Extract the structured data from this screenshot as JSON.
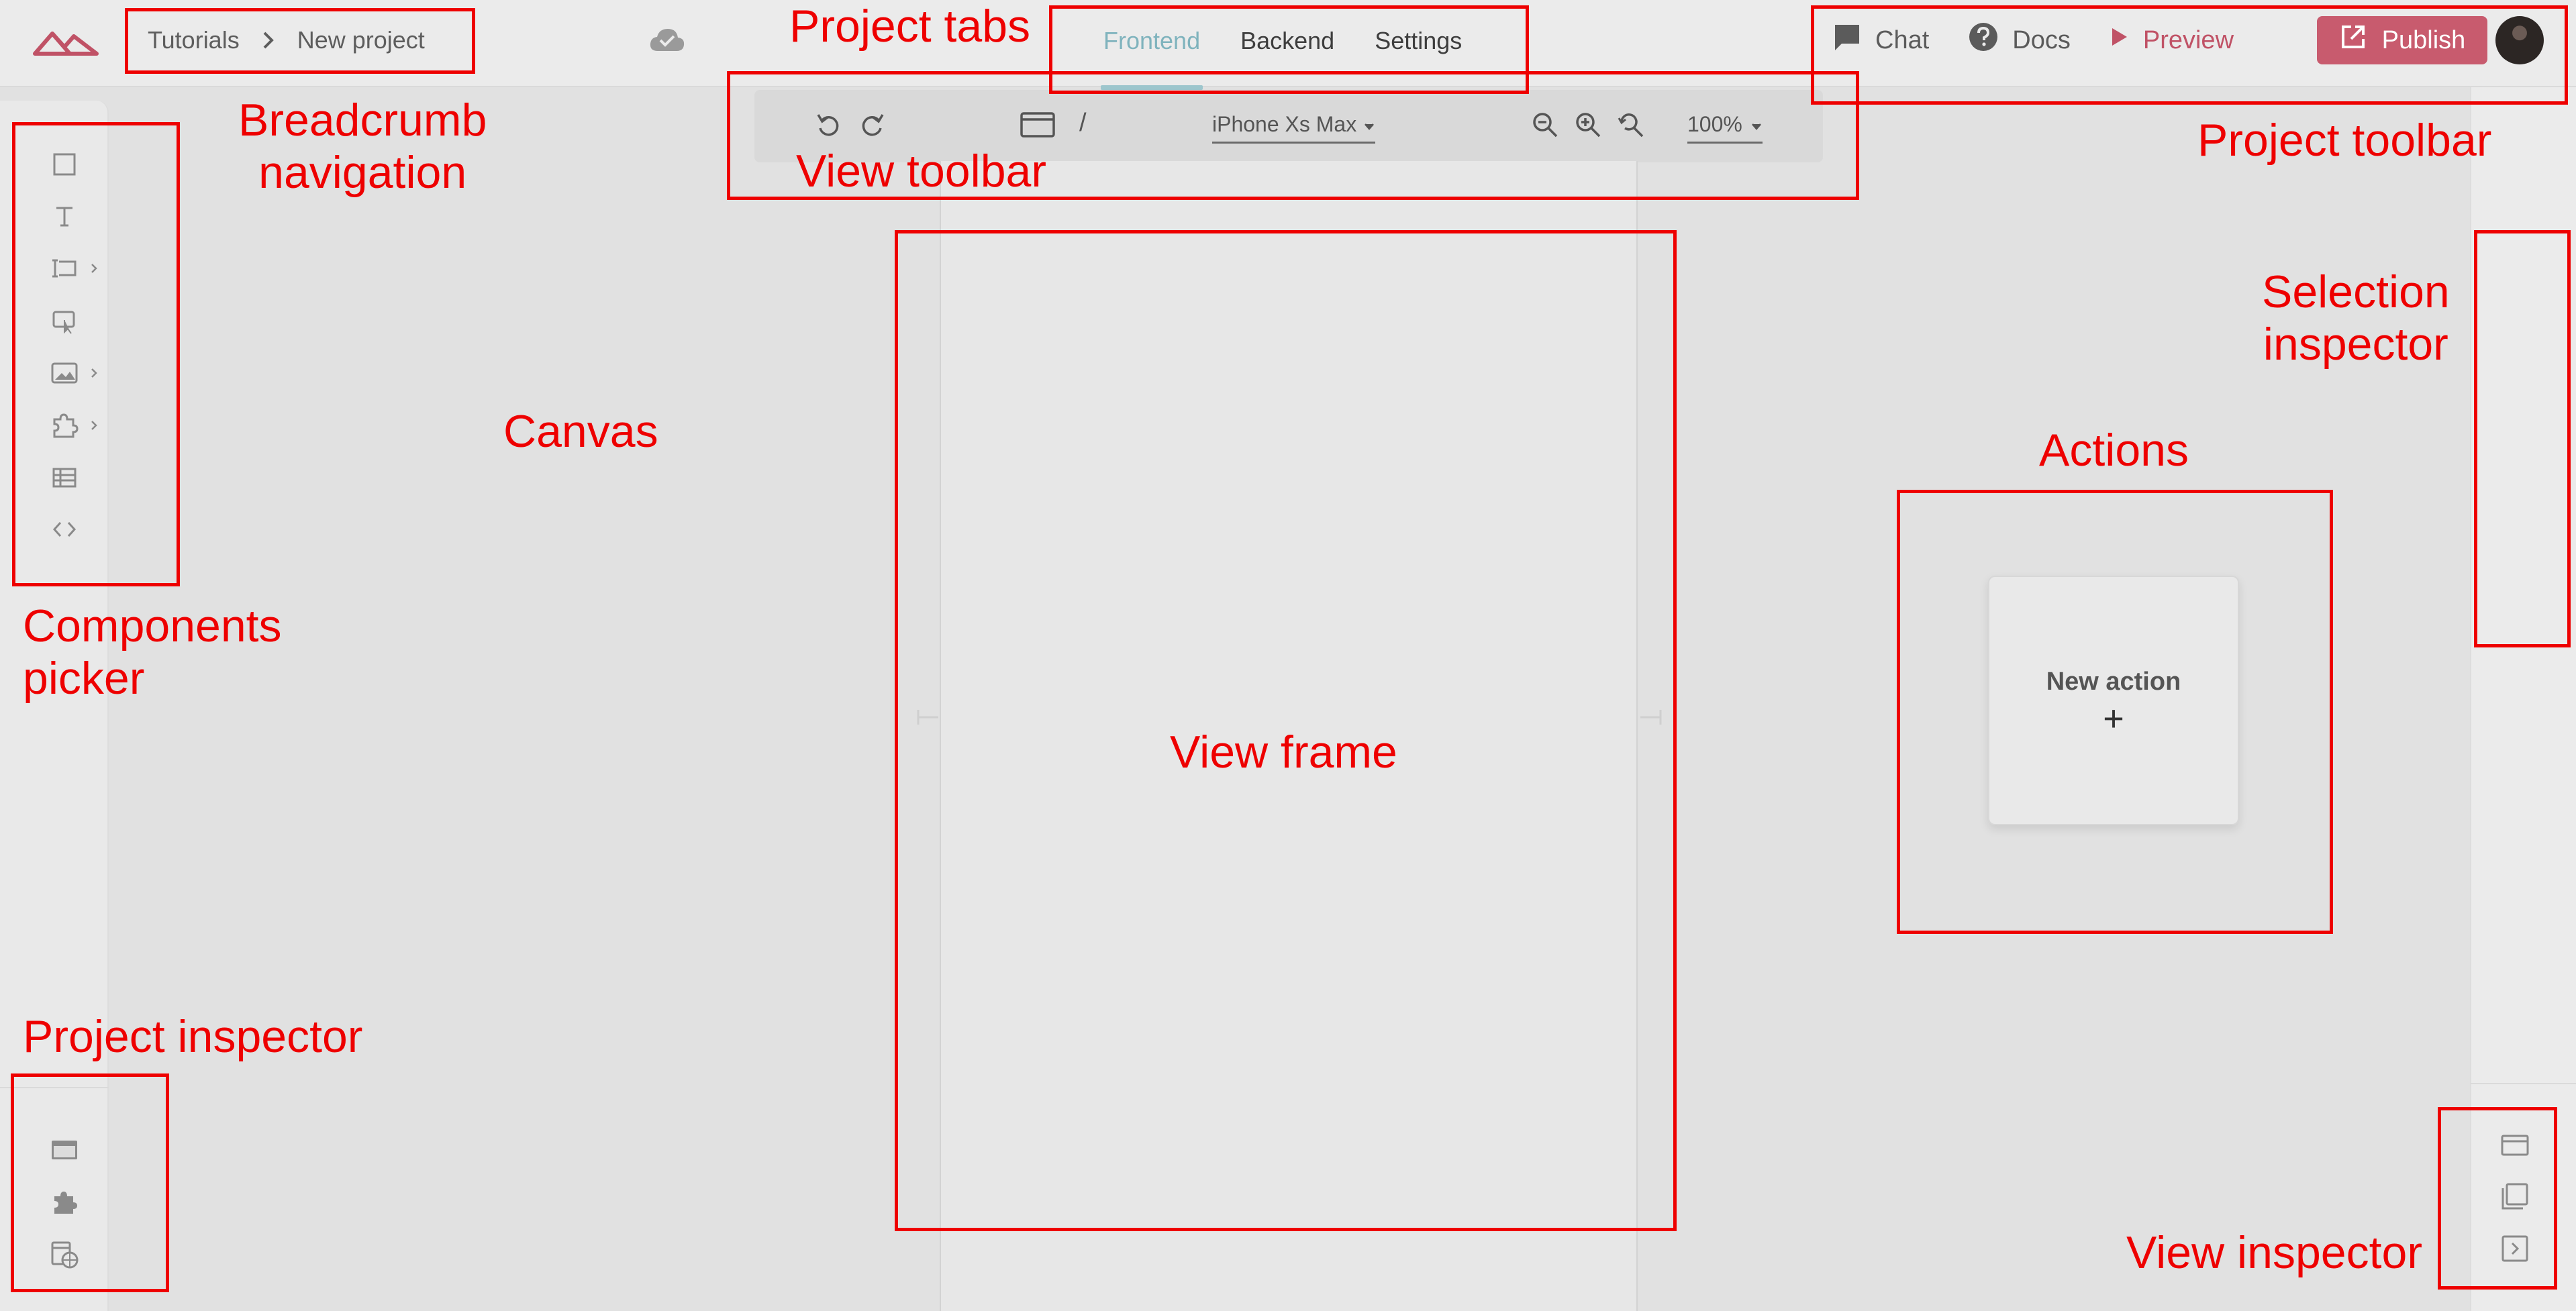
{
  "app": {
    "logo_icon": "brand-logo-icon",
    "save_status_icon": "cloud-check-icon"
  },
  "breadcrumb": {
    "items": [
      "Tutorials",
      "New project"
    ],
    "separator_icon": "chevron-right-icon"
  },
  "tabs": [
    {
      "label": "Frontend",
      "active": true
    },
    {
      "label": "Backend",
      "active": false
    },
    {
      "label": "Settings",
      "active": false
    }
  ],
  "project_toolbar": {
    "chat": {
      "label": "Chat",
      "icon": "chat-bubble-icon"
    },
    "docs": {
      "label": "Docs",
      "icon": "help-circle-icon"
    },
    "preview": {
      "label": "Preview",
      "icon": "play-icon"
    },
    "publish": {
      "label": "Publish",
      "icon": "external-link-icon"
    },
    "avatar_icon": "user-avatar"
  },
  "view_toolbar": {
    "undo_icon": "undo-icon",
    "redo_icon": "redo-icon",
    "view_icon": "window-icon",
    "path": "/",
    "device": "iPhone Xs Max",
    "zoom_out_icon": "zoom-out-icon",
    "zoom_in_icon": "zoom-in-icon",
    "zoom_reset_icon": "zoom-reset-icon",
    "zoom": "100%"
  },
  "components_picker": [
    {
      "name": "container",
      "icon": "square-icon",
      "has_submenu": false
    },
    {
      "name": "text",
      "icon": "text-icon",
      "has_submenu": false
    },
    {
      "name": "input",
      "icon": "input-icon",
      "has_submenu": true
    },
    {
      "name": "button",
      "icon": "button-icon",
      "has_submenu": false
    },
    {
      "name": "media",
      "icon": "image-icon",
      "has_submenu": true
    },
    {
      "name": "plugins",
      "icon": "puzzle-icon",
      "has_submenu": true
    },
    {
      "name": "table",
      "icon": "table-icon",
      "has_submenu": false
    },
    {
      "name": "code",
      "icon": "code-icon",
      "has_submenu": false
    }
  ],
  "project_inspector": [
    "views-icon",
    "plugins-icon",
    "database-icon"
  ],
  "view_inspector": [
    "view-icon",
    "layers-icon",
    "expand-panel-icon"
  ],
  "actions": {
    "new_action_label": "New action",
    "add_symbol": "+"
  },
  "annotations": {
    "breadcrumb": "Breadcrumb\nnavigation",
    "project_tabs": "Project tabs",
    "project_toolbar": "Project toolbar",
    "view_toolbar": "View toolbar",
    "components_picker": "Components\npicker",
    "canvas": "Canvas",
    "view_frame": "View frame",
    "actions": "Actions",
    "selection_inspector": "Selection\ninspector",
    "project_inspector": "Project inspector",
    "view_inspector": "View inspector"
  },
  "colors": {
    "accent_teal": "#7fb3bd",
    "brand_red": "#c85b6e",
    "annotation_red": "#ee0000"
  }
}
